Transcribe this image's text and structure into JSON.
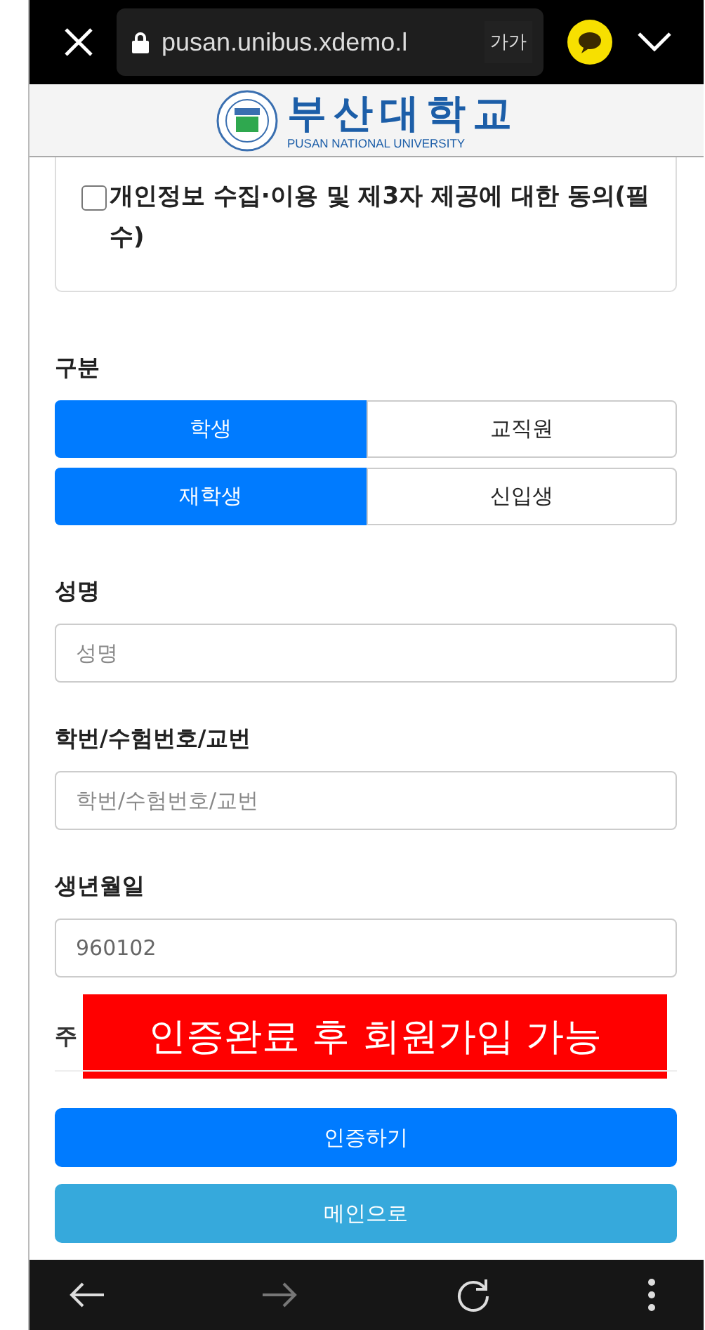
{
  "browser_bar": {
    "url": "pusan.unibus.xdemo.l",
    "text_size_button": "가가"
  },
  "header": {
    "logo_title": "부산대학교",
    "logo_subtitle": "PUSAN NATIONAL UNIVERSITY"
  },
  "consent": {
    "label": "개인정보 수집·이용 및 제3자 제공에 대한 동의(필수)",
    "checked": false
  },
  "category": {
    "label": "구분",
    "groups": [
      [
        {
          "label": "학생",
          "selected": true
        },
        {
          "label": "교직원",
          "selected": false
        }
      ],
      [
        {
          "label": "재학생",
          "selected": true
        },
        {
          "label": "신입생",
          "selected": false
        }
      ]
    ]
  },
  "fields": [
    {
      "label": "성명",
      "placeholder": "성명"
    },
    {
      "label": "학번/수험번호/교번",
      "placeholder": "학번/수험번호/교번"
    },
    {
      "label": "생년월일",
      "value": "960102"
    }
  ],
  "address_label": "주",
  "banner": "인증완료 후 회원가입 가능",
  "buttons": [
    {
      "label": "인증하기",
      "kind": "primary"
    },
    {
      "label": "메인으로",
      "kind": "info"
    }
  ]
}
